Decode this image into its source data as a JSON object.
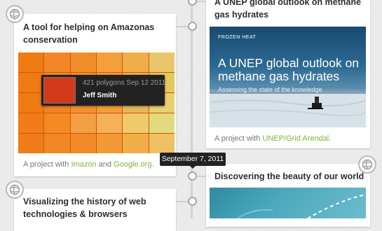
{
  "timeline": {
    "date_label": "September 7, 2011"
  },
  "cards": {
    "amazonas": {
      "title": "A tool for helping on Amazonas conservation",
      "meta_prefix": "A project with ",
      "link1": "Imazon",
      "meta_and": " and ",
      "link2": "Google.org",
      "meta_suffix": ".",
      "tooltip_info": "421 polygons Sep 12 2011",
      "tooltip_user": "Jeff Smith",
      "heatmap_colors": [
        "#f07a14",
        "#f4862a",
        "#f28e2a",
        "#f39f3a",
        "#f0ae4a",
        "#e9c66a",
        "#f07a14",
        "#f28a2e",
        "#f4952c",
        "#f4a23e",
        "#efb24c",
        "#e3c860",
        "#f07a14",
        "#f28228",
        "#f39035",
        "#f49e39",
        "#e8b65a",
        "#e9cf72",
        "#f17c18",
        "#f38a24",
        "#f3a044",
        "#f5b05a",
        "#efca6c",
        "#e2da7e",
        "#f27c1a",
        "#f28726",
        "#f28a2a",
        "#f39a38",
        "#f2ae48",
        "#eec263"
      ]
    },
    "unep_top": {
      "title": "A UNEP global outlook on methane gas hydrates",
      "image_kicker": "FROZEN HEAT",
      "image_heading": "A UNEP global outlook on methane gas hydrates",
      "image_sub": "Assessing the state of the knowledge",
      "meta_prefix": "A project with ",
      "link1": "UNEP/Grid Arendal",
      "meta_suffix": "."
    },
    "beauty": {
      "title": "Discovering the beauty of our world"
    },
    "history": {
      "title": "Visualizing the history of web technologies & browsers"
    }
  },
  "colors": {
    "link_green": "#7cb33a",
    "tooltip_bg": "#222222",
    "title_text": "#2e2e2e"
  },
  "icons": {
    "badge": "globe-icon"
  }
}
